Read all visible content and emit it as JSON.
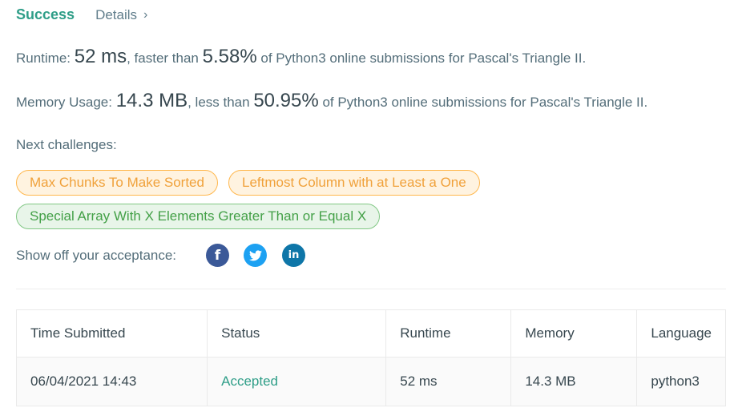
{
  "header": {
    "status": "Success",
    "details_label": "Details",
    "details_chevron": "›"
  },
  "runtime": {
    "prefix": "Runtime: ",
    "value": "52 ms",
    "middle": ", faster than ",
    "percent": "5.58%",
    "suffix": " of Python3 online submissions for Pascal's Triangle II."
  },
  "memory": {
    "prefix": "Memory Usage: ",
    "value": "14.3 MB",
    "middle": ", less than ",
    "percent": "50.95%",
    "suffix": " of Python3 online submissions for Pascal's Triangle II."
  },
  "next_challenges": {
    "label": "Next challenges:",
    "items": [
      {
        "title": "Max Chunks To Make Sorted",
        "difficulty_color": "orange"
      },
      {
        "title": "Leftmost Column with at Least a One",
        "difficulty_color": "orange"
      },
      {
        "title": "Special Array With X Elements Greater Than or Equal X",
        "difficulty_color": "green"
      }
    ]
  },
  "share": {
    "label": "Show off your acceptance:",
    "icons": [
      {
        "name": "facebook-icon",
        "glyph": "f",
        "color": "#3b5998"
      },
      {
        "name": "twitter-icon",
        "glyph": "t",
        "color": "#1da1f2"
      },
      {
        "name": "linkedin-icon",
        "glyph": "in",
        "color": "#0e76a8"
      }
    ]
  },
  "submissions": {
    "columns": [
      "Time Submitted",
      "Status",
      "Runtime",
      "Memory",
      "Language"
    ],
    "rows": [
      {
        "time": "06/04/2021 14:43",
        "status": "Accepted",
        "runtime": "52 ms",
        "memory": "14.3 MB",
        "language": "python3"
      }
    ]
  },
  "colors": {
    "success": "#2f9e88",
    "accepted": "#2f9e88",
    "chip_orange_text": "#f0a13a",
    "chip_green_text": "#43a047"
  }
}
